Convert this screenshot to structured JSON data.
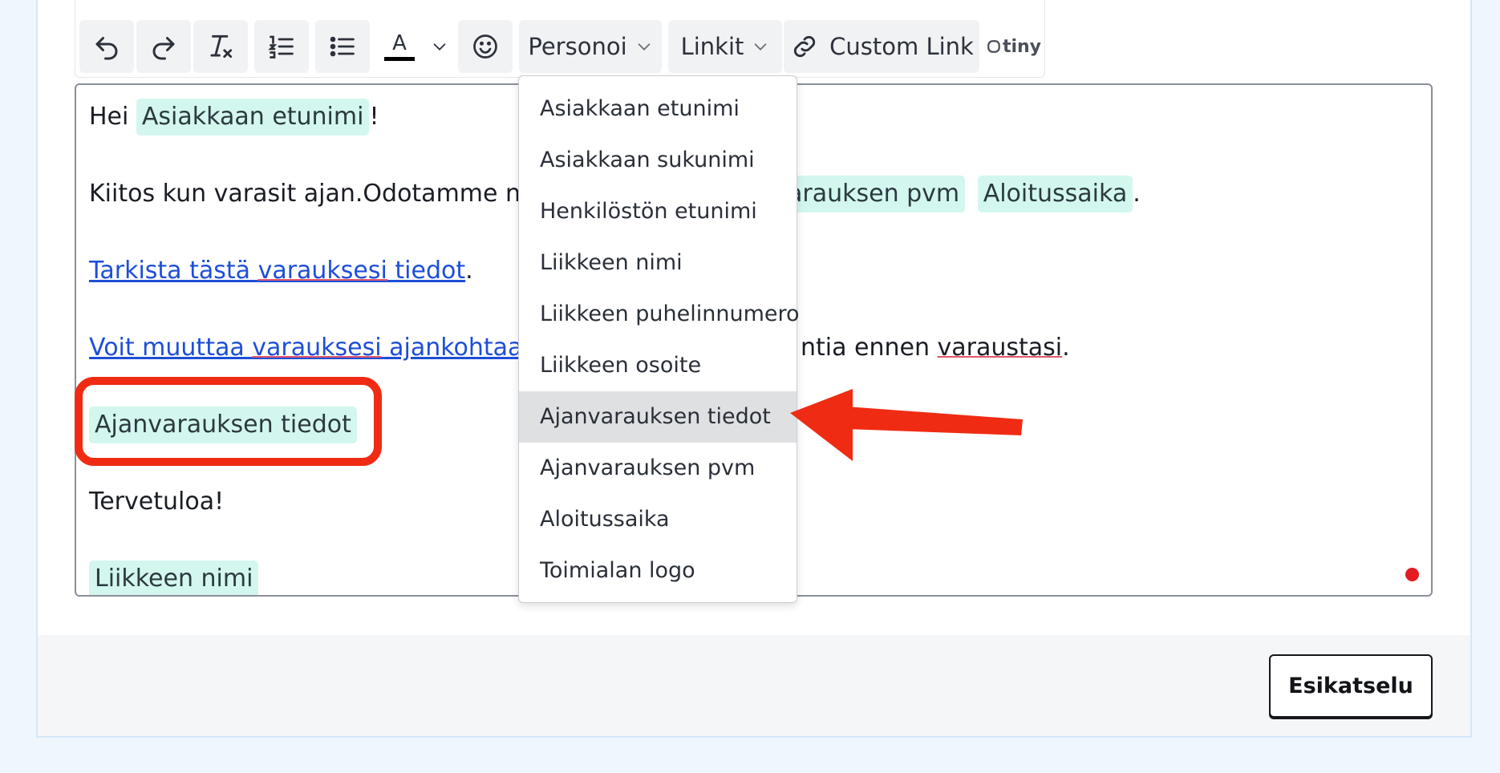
{
  "toolbar": {
    "personalize_label": "Personoi",
    "links_label": "Linkit",
    "custom_link_label": "Custom Link",
    "tiny_logo": "tiny",
    "text_color_letter": "A",
    "text_color_swatch": "#000000"
  },
  "editor": {
    "greeting": "Hei",
    "greeting_tag": "Asiakkaan etunimi",
    "greeting_end": "!",
    "thanks_text": "Kiitos kun varasit ajan.Odotamme n",
    "thanks_tag_date": "arauksen pvm",
    "thanks_tag_time": "Aloitussaika",
    "thanks_end": ".",
    "check_link_a": "Tarkista tästä ",
    "check_link_b": "varauksesi",
    "check_link_c": " tiedot",
    "check_end": ".",
    "change_link_a": "Voit muuttaa ",
    "change_link_b": "varauksesi",
    "change_link_c": " ajankohtaa",
    "change_text_a": "ntia ennen ",
    "change_text_b": "varaustasi",
    "change_text_end": ".",
    "booking_details_tag": "Ajanvarauksen tiedot",
    "welcome": "Tervetuloa!",
    "business_name_tag": "Liikkeen nimi"
  },
  "dropdown": {
    "items": [
      {
        "label": "Asiakkaan etunimi"
      },
      {
        "label": "Asiakkaan sukunimi"
      },
      {
        "label": "Henkilöstön etunimi"
      },
      {
        "label": "Liikkeen nimi"
      },
      {
        "label": "Liikkeen puhelinnumero"
      },
      {
        "label": "Liikkeen osoite"
      },
      {
        "label": "Ajanvarauksen tiedot",
        "active": true
      },
      {
        "label": "Ajanvarauksen pvm"
      },
      {
        "label": "Aloitussaika"
      },
      {
        "label": "Toimialan logo"
      }
    ]
  },
  "footer": {
    "preview_label": "Esikatselu"
  },
  "colors": {
    "annotation_red": "#f02b13",
    "tag_bg": "#d3f7ef",
    "link_blue": "#1d4ed8"
  }
}
